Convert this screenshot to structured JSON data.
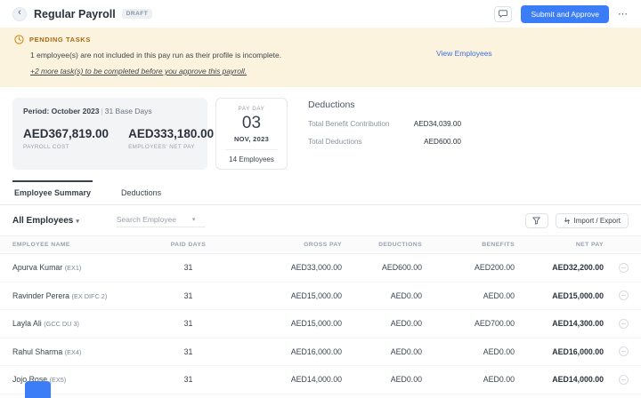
{
  "icons": {
    "back": "‹",
    "more": "⋯",
    "caret": "▾"
  },
  "colors": {
    "primary": "#3b7cf7",
    "banner_bg": "#fbf3de",
    "banner_title": "#a8690f",
    "link": "#3a6ee0"
  },
  "header": {
    "title": "Regular Payroll",
    "badge": "DRAFT",
    "submit_label": "Submit and Approve"
  },
  "banner": {
    "title": "PENDING TASKS",
    "line1": "1 employee(s) are not included in this pay run as their profile is incomplete.",
    "view_link": "View Employees",
    "line2": "+2 more task(s) to be completed before you approve this payroll."
  },
  "summary": {
    "period_label": "Period: October 2023",
    "base_days": "31 Base Days",
    "payroll_cost": "AED367,819.00",
    "payroll_cost_label": "PAYROLL COST",
    "net_pay": "AED333,180.00",
    "net_pay_label": "EMPLOYEES' NET PAY",
    "payday": {
      "label": "PAY DAY",
      "day": "03",
      "month_year": "NOV, 2023",
      "employees": "14 Employees"
    },
    "deductions": {
      "title": "Deductions",
      "rows": [
        {
          "label": "Total Benefit Contribution",
          "value": "AED34,039.00"
        },
        {
          "label": "Total Deductions",
          "value": "AED600.00"
        }
      ]
    }
  },
  "tabs": [
    {
      "label": "Employee Summary"
    },
    {
      "label": "Deductions"
    }
  ],
  "toolbar": {
    "employee_filter": "All Employees",
    "search_placeholder": "Search Employee",
    "import_export_label": "Import / Export"
  },
  "table": {
    "columns": [
      "EMPLOYEE NAME",
      "PAID DAYS",
      "GROSS PAY",
      "DEDUCTIONS",
      "BENEFITS",
      "NET PAY"
    ],
    "rows": [
      {
        "name": "Apurva Kumar",
        "tag": "(EX1)",
        "paid_days": "31",
        "gross": "AED33,000.00",
        "deductions": "AED600.00",
        "benefits": "AED200.00",
        "net": "AED32,200.00"
      },
      {
        "name": "Ravinder Perera",
        "tag": "(EX DIFC 2)",
        "paid_days": "31",
        "gross": "AED15,000.00",
        "deductions": "AED0.00",
        "benefits": "AED0.00",
        "net": "AED15,000.00"
      },
      {
        "name": "Layla Ali",
        "tag": "(GCC DU 3)",
        "paid_days": "31",
        "gross": "AED15,000.00",
        "deductions": "AED0.00",
        "benefits": "AED700.00",
        "net": "AED14,300.00"
      },
      {
        "name": "Rahul Sharma",
        "tag": "(EX4)",
        "paid_days": "31",
        "gross": "AED16,000.00",
        "deductions": "AED0.00",
        "benefits": "AED0.00",
        "net": "AED16,000.00"
      },
      {
        "name": "Jojo Rose",
        "tag": "(EX5)",
        "paid_days": "31",
        "gross": "AED14,000.00",
        "deductions": "AED0.00",
        "benefits": "AED0.00",
        "net": "AED14,000.00"
      }
    ]
  }
}
